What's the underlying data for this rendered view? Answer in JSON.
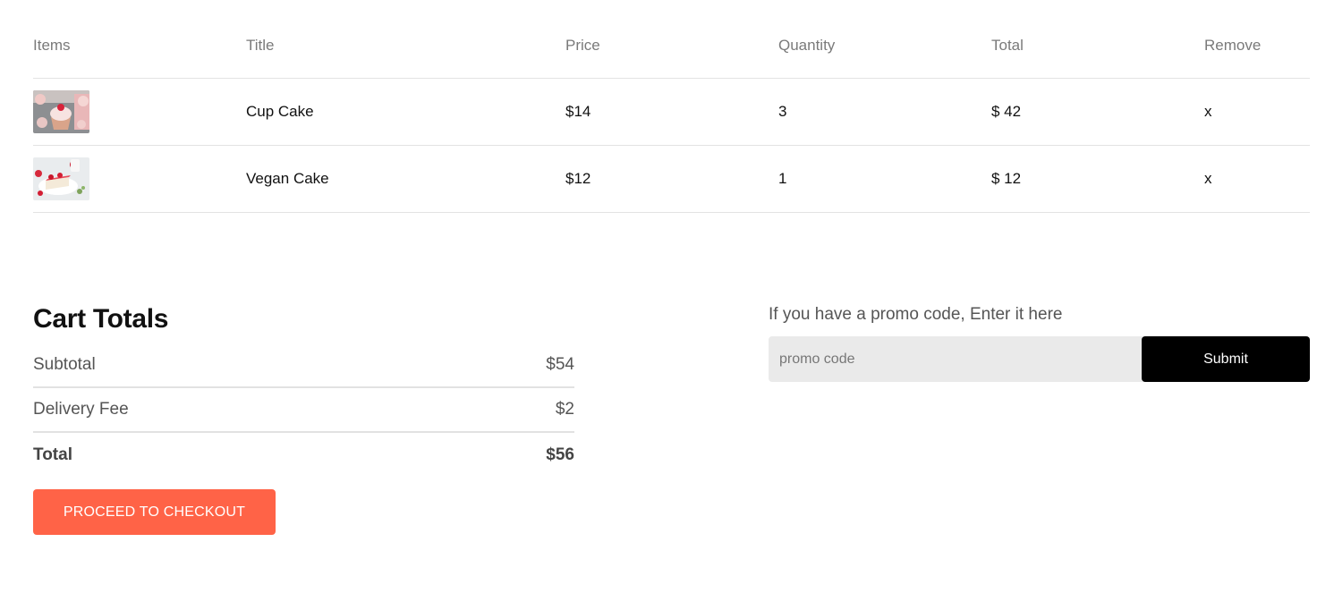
{
  "table": {
    "headers": [
      "Items",
      "Title",
      "Price",
      "Quantity",
      "Total",
      "Remove"
    ],
    "rows": [
      {
        "image": "cupcake-image",
        "title": "Cup Cake",
        "price": "$14",
        "quantity": "3",
        "total": "$ 42",
        "remove": "x"
      },
      {
        "image": "vegan-cake-image",
        "title": "Vegan Cake",
        "price": "$12",
        "quantity": "1",
        "total": "$ 12",
        "remove": "x"
      }
    ]
  },
  "totals": {
    "heading": "Cart Totals",
    "subtotal_label": "Subtotal",
    "subtotal_value": "$54",
    "delivery_label": "Delivery Fee",
    "delivery_value": "$2",
    "total_label": "Total",
    "total_value": "$56",
    "checkout_label": "PROCEED TO CHECKOUT"
  },
  "promo": {
    "label": "If you have a promo code, Enter it here",
    "placeholder": "promo code",
    "value": "",
    "submit_label": "Submit"
  },
  "colors": {
    "accent": "#ff6347",
    "submit": "#000000",
    "input_bg": "#eaeaea"
  }
}
